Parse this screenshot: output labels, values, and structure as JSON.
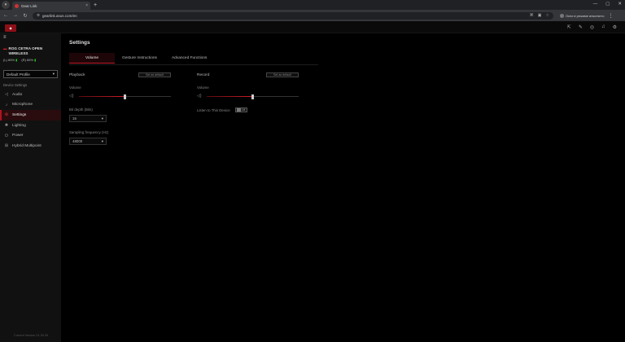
{
  "browser": {
    "tab_title": "Gear Link",
    "url": "gearlink.asus.com/en",
    "incognito_label": "Окно в режиме инкогнито"
  },
  "sidebar": {
    "device_name": "ROG CETRA OPEN WIRELESS",
    "battery_left": "(L) 65%",
    "battery_right": "(R) 65%",
    "profile": "Default Profile",
    "section_label": "Device Settings",
    "items": [
      {
        "label": "Audio",
        "icon": "speaker-icon"
      },
      {
        "label": "Microphone",
        "icon": "microphone-icon"
      },
      {
        "label": "Settings",
        "icon": "gear-icon"
      },
      {
        "label": "Lighting",
        "icon": "light-icon"
      },
      {
        "label": "Power",
        "icon": "power-icon"
      },
      {
        "label": "Hybrid Multipoint",
        "icon": "multipoint-icon"
      }
    ],
    "active_item": "Settings",
    "firmware": "Current Version 01.00.09"
  },
  "main": {
    "title": "Settings",
    "tabs": [
      "Volume",
      "Gesture Instructions",
      "Advanced Functions"
    ],
    "active_tab": "Volume",
    "playback": {
      "label": "Playback",
      "default_button": "Set as default",
      "volume_label": "Volume",
      "volume_value": 50,
      "bit_depth_label": "Bit depth (Bits)",
      "bit_depth_value": "16",
      "sampling_label": "Sampling frequency (Hz)",
      "sampling_value": "48000"
    },
    "record": {
      "label": "Record",
      "default_button": "Set as default",
      "volume_label": "Volume",
      "volume_value": 50,
      "listen_label": "Listen to This Device",
      "listen_toggle": "Off"
    }
  },
  "colors": {
    "accent": "#c01b26",
    "background": "#000000",
    "sidebar": "#111111"
  }
}
